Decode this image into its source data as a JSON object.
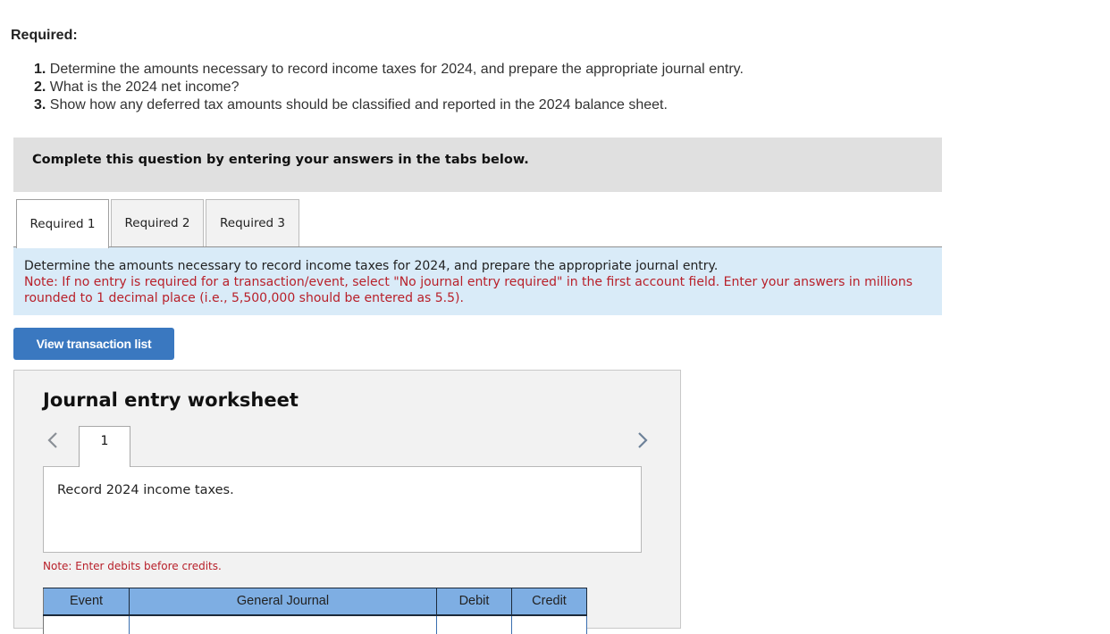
{
  "required": {
    "heading": "Required:",
    "items": [
      {
        "num": "1.",
        "text": " Determine the amounts necessary to record income taxes for 2024, and prepare the appropriate journal entry."
      },
      {
        "num": "2.",
        "text": " What is the 2024 net income?"
      },
      {
        "num": "3.",
        "text": " Show how any deferred tax amounts should be classified and reported in the 2024 balance sheet."
      }
    ]
  },
  "instruction_bar": "Complete this question by entering your answers in the tabs below.",
  "tabs": [
    {
      "label": "Required 1",
      "active": true
    },
    {
      "label": "Required 2",
      "active": false
    },
    {
      "label": "Required 3",
      "active": false
    }
  ],
  "task_panel": {
    "main": "Determine the amounts necessary to record income taxes for 2024, and prepare the appropriate journal entry.",
    "note": "Note: If no entry is required for a transaction/event, select \"No journal entry required\" in the first account field. Enter your answers in millions rounded to 1 decimal place (i.e., 5,500,000 should be entered as 5.5)."
  },
  "view_transaction_button": "View transaction list",
  "worksheet": {
    "title": "Journal entry worksheet",
    "current_entry": "1",
    "prev_icon": "chevron-left-icon",
    "next_icon": "chevron-right-icon",
    "description": "Record 2024 income taxes.",
    "note": "Note: Enter debits before credits.",
    "table_headers": [
      "Event",
      "General Journal",
      "Debit",
      "Credit"
    ]
  },
  "colors": {
    "accent_button": "#3a78c0",
    "note_red": "#b8202a",
    "table_header": "#7eaee3",
    "task_panel_bg": "#d9ebf8"
  }
}
